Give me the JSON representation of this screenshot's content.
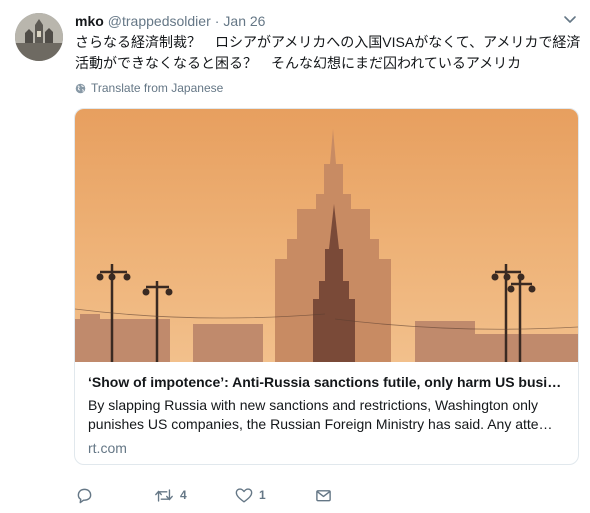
{
  "tweet": {
    "display_name": "mko",
    "handle": "@trappedsoldier",
    "separator": "·",
    "date": "Jan 26",
    "text_lines": [
      "さらなる経済制裁？　ロシアがアメリカへの入国VISAがなくて、アメリカで経済",
      "活動ができなくなると困る？　そんな幻想にまだ囚われているアメリカ"
    ],
    "translate_label": "Translate from Japanese"
  },
  "card": {
    "title": "‘Show of impotence’: Anti-Russia sanctions futile, only harm US busi…",
    "description_lines": [
      "By slapping Russia with new sanctions and restrictions, Washington only",
      "punishes US companies, the Russian Foreign Ministry has said. Any atte…"
    ],
    "domain": "rt.com"
  },
  "actions": {
    "retweet_count": "4",
    "like_count": "1"
  },
  "icons": {
    "menu": "chevron-down-icon",
    "translate": "globe-icon",
    "reply": "reply-icon",
    "retweet": "retweet-icon",
    "like": "heart-icon",
    "dm": "envelope-icon"
  },
  "colors": {
    "text": "#14171a",
    "secondary": "#657786",
    "border": "#e1e8ed",
    "sky": "#e8a866"
  }
}
